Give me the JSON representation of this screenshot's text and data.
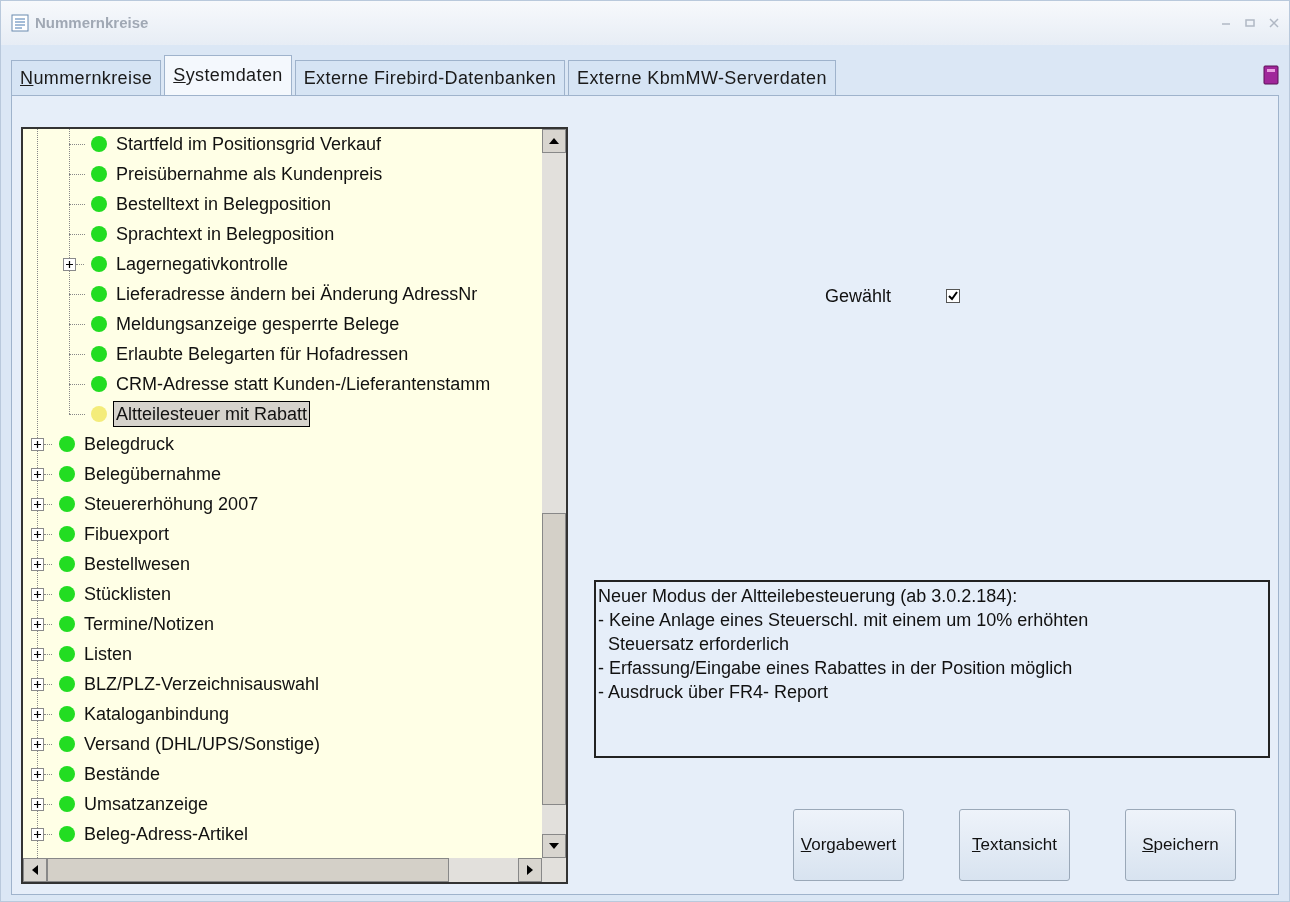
{
  "window": {
    "title": "Nummernkreise"
  },
  "tabs": [
    {
      "label": "Nummernkreise",
      "selected": false,
      "mnemonic": true
    },
    {
      "label": "Systemdaten",
      "selected": true,
      "mnemonic": true
    },
    {
      "label": "Externe Firebird-Datenbanken",
      "selected": false,
      "mnemonic": false
    },
    {
      "label": "Externe KbmMW-Serverdaten",
      "selected": false,
      "mnemonic": false
    }
  ],
  "tree": {
    "items": [
      {
        "children": [
          {
            "label": "Startfeld im Positionsgrid Verkauf",
            "color": "#22dd22",
            "expandable": false,
            "selected": false
          },
          {
            "label": "Preisübernahme als Kundenpreis",
            "color": "#22dd22",
            "expandable": false,
            "selected": false
          },
          {
            "label": "Bestelltext in Belegposition",
            "color": "#22dd22",
            "expandable": false,
            "selected": false
          },
          {
            "label": "Sprachtext in Belegposition",
            "color": "#22dd22",
            "expandable": false,
            "selected": false
          },
          {
            "label": "Lagernegativkontrolle",
            "color": "#22dd22",
            "expandable": true,
            "selected": false
          },
          {
            "label": "Lieferadresse ändern bei Änderung AdressNr",
            "color": "#22dd22",
            "expandable": false,
            "selected": false
          },
          {
            "label": "Meldungsanzeige gesperrte Belege",
            "color": "#22dd22",
            "expandable": false,
            "selected": false
          },
          {
            "label": "Erlaubte Belegarten für Hofadressen",
            "color": "#22dd22",
            "expandable": false,
            "selected": false
          },
          {
            "label": "CRM-Adresse statt Kunden-/Lieferantenstamm",
            "color": "#22dd22",
            "expandable": false,
            "selected": false
          },
          {
            "label": "Altteilesteuer mit Rabatt",
            "color": "#f4ec7a",
            "expandable": false,
            "selected": true
          }
        ]
      },
      {
        "label": "Belegdruck",
        "color": "#22dd22",
        "expandable": true,
        "selected": false
      },
      {
        "label": "Belegübernahme",
        "color": "#22dd22",
        "expandable": true,
        "selected": false
      },
      {
        "label": "Steuererhöhung 2007",
        "color": "#22dd22",
        "expandable": true,
        "selected": false
      },
      {
        "label": "Fibuexport",
        "color": "#22dd22",
        "expandable": true,
        "selected": false
      },
      {
        "label": "Bestellwesen",
        "color": "#22dd22",
        "expandable": true,
        "selected": false
      },
      {
        "label": "Stücklisten",
        "color": "#22dd22",
        "expandable": true,
        "selected": false
      },
      {
        "label": "Termine/Notizen",
        "color": "#22dd22",
        "expandable": true,
        "selected": false
      },
      {
        "label": "Listen",
        "color": "#22dd22",
        "expandable": true,
        "selected": false
      },
      {
        "label": "BLZ/PLZ-Verzeichnisauswahl",
        "color": "#22dd22",
        "expandable": true,
        "selected": false
      },
      {
        "label": "Kataloganbindung",
        "color": "#22dd22",
        "expandable": true,
        "selected": false
      },
      {
        "label": "Versand (DHL/UPS/Sonstige)",
        "color": "#22dd22",
        "expandable": true,
        "selected": false
      },
      {
        "label": "Bestände",
        "color": "#22dd22",
        "expandable": true,
        "selected": false
      },
      {
        "label": "Umsatzanzeige",
        "color": "#22dd22",
        "expandable": true,
        "selected": false
      },
      {
        "label": "Beleg-Adress-Artikel",
        "color": "#22dd22",
        "expandable": true,
        "selected": false
      }
    ]
  },
  "setting": {
    "label": "Gewählt",
    "checked": true
  },
  "description": [
    "Neuer Modus der Altteilebesteuerung (ab 3.0.2.184):",
    "- Keine Anlage eines Steuerschl. mit einem um 10% erhöhten",
    "  Steuersatz erforderlich",
    "- Erfassung/Eingabe eines Rabattes in der Position möglich",
    "- Ausdruck über FR4- Report"
  ],
  "buttons": [
    {
      "label": "Vorgabewert",
      "mnemonic": true
    },
    {
      "label": "Textansicht",
      "mnemonic": true
    },
    {
      "label": "Speichern",
      "mnemonic": true
    }
  ]
}
